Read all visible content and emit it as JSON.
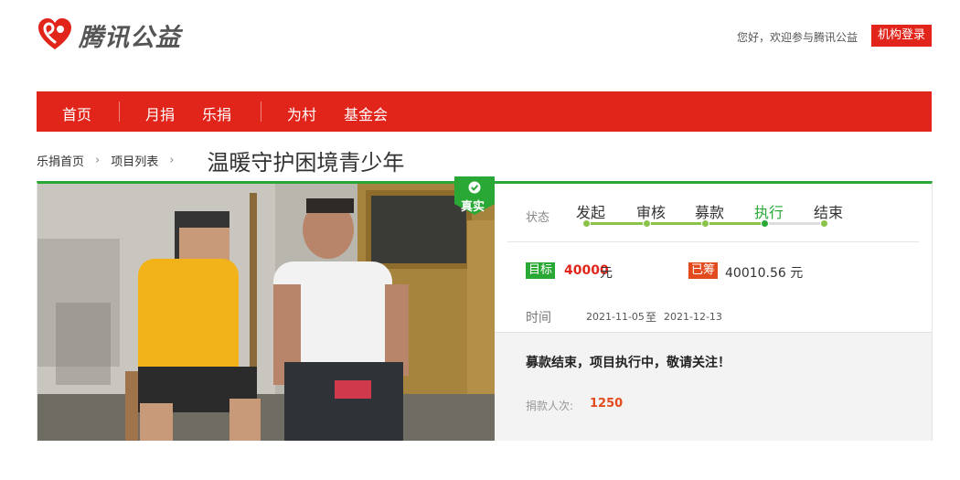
{
  "header": {
    "logo_text": "腾讯公益",
    "welcome": "您好，欢迎参与腾讯公益",
    "org_login": "机构登录"
  },
  "nav": {
    "items": [
      {
        "label": "首页"
      },
      {
        "label": "月捐"
      },
      {
        "label": "乐捐"
      },
      {
        "label": "为村"
      },
      {
        "label": "基金会"
      }
    ]
  },
  "breadcrumb": {
    "items": [
      {
        "label": "乐捐首页"
      },
      {
        "label": "项目列表"
      }
    ],
    "arrow": "›",
    "title": "温暖守护困境青少年"
  },
  "project": {
    "badge": "真实",
    "status_label": "状态",
    "steps": [
      {
        "label": "发起",
        "active": false
      },
      {
        "label": "审核",
        "active": false
      },
      {
        "label": "募款",
        "active": false
      },
      {
        "label": "执行",
        "active": true
      },
      {
        "label": "结束",
        "active": false
      }
    ],
    "target_label": "目标",
    "target_value": "40000",
    "target_unit": "元",
    "raised_label": "已筹",
    "raised_value": "40010.56 元",
    "time_label": "时间",
    "time_start": "2021-11-05",
    "time_sep": "至",
    "time_end": "2021-12-13",
    "notice": "募款结束，项目执行中，敬请关注！",
    "donors_label": "捐款人次:",
    "donors_value": "1250"
  },
  "colors": {
    "brand_red": "#e1251b",
    "progress_green": "#2aa836",
    "raised_orange": "#e34a1e"
  }
}
